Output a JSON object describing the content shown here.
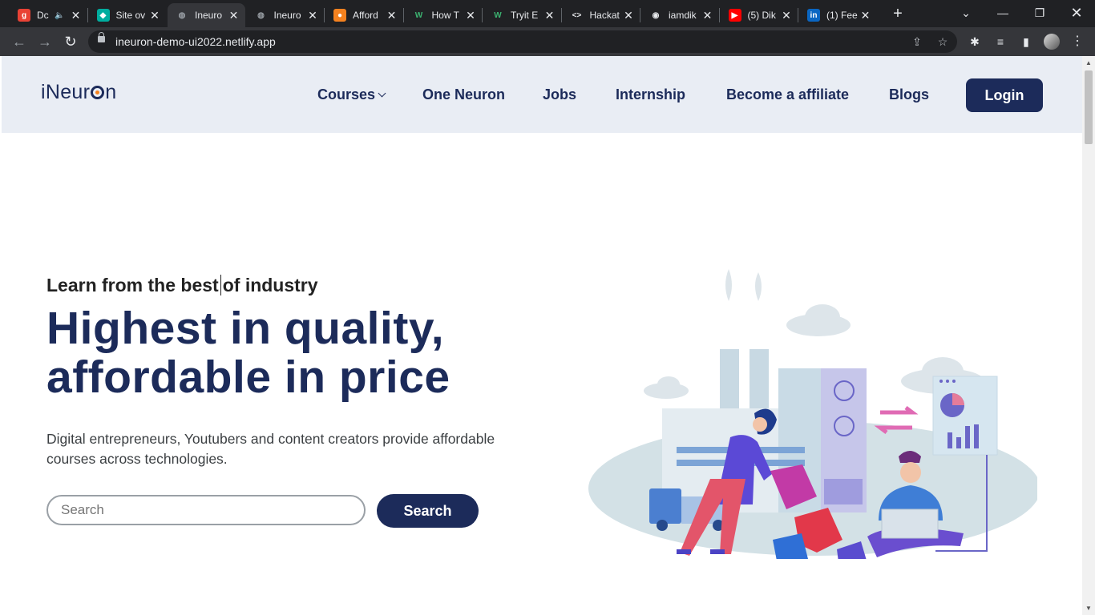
{
  "browser": {
    "tabs": [
      {
        "title": "Dc",
        "favicon": "g-icon",
        "color": "#e94235",
        "glyph": "g",
        "audio": true
      },
      {
        "title": "Site ov",
        "favicon": "netlify-icon",
        "color": "#00ad9f",
        "glyph": "◆"
      },
      {
        "title": "Ineuro",
        "favicon": "globe-icon",
        "color": "#5f6368",
        "glyph": "◍",
        "active": true
      },
      {
        "title": "Ineuro",
        "favicon": "globe-icon",
        "color": "#5f6368",
        "glyph": "◍"
      },
      {
        "title": "Afford",
        "favicon": "orange-dot-icon",
        "color": "#f5821f",
        "glyph": "●"
      },
      {
        "title": "How T",
        "favicon": "w-icon",
        "color": "#202124",
        "glyph": "W"
      },
      {
        "title": "Tryit E",
        "favicon": "w-icon",
        "color": "#202124",
        "glyph": "W"
      },
      {
        "title": "Hackat",
        "favicon": "code-icon",
        "color": "#202124",
        "glyph": "<>"
      },
      {
        "title": "iamdik",
        "favicon": "github-icon",
        "color": "#202124",
        "glyph": "◉"
      },
      {
        "title": "(5) Dik",
        "favicon": "youtube-icon",
        "color": "#ff0000",
        "glyph": "▶"
      },
      {
        "title": "(1) Fee",
        "favicon": "linkedin-icon",
        "color": "#0a66c2",
        "glyph": "in"
      }
    ],
    "url": "ineuron-demo-ui2022.netlify.app"
  },
  "header": {
    "logo": {
      "pre": "iNeur",
      "post": "n"
    },
    "nav": {
      "courses": "Courses",
      "one_neuron": "One Neuron",
      "jobs": "Jobs",
      "internship": "Internship",
      "affiliate": "Become a affiliate",
      "blogs": "Blogs"
    },
    "login": "Login"
  },
  "hero": {
    "tagline_a": "Learn from the best",
    "tagline_b": "of industry",
    "headline_1": "Highest in quality,",
    "headline_2": "affordable in price",
    "description": "Digital entrepreneurs, Youtubers and content creators provide affordable courses across technologies.",
    "search_placeholder": "Search",
    "search_button": "Search"
  },
  "colors": {
    "brand": "#1c2b5a",
    "header_bg": "#e9edf4",
    "accent": "#f5821f"
  }
}
